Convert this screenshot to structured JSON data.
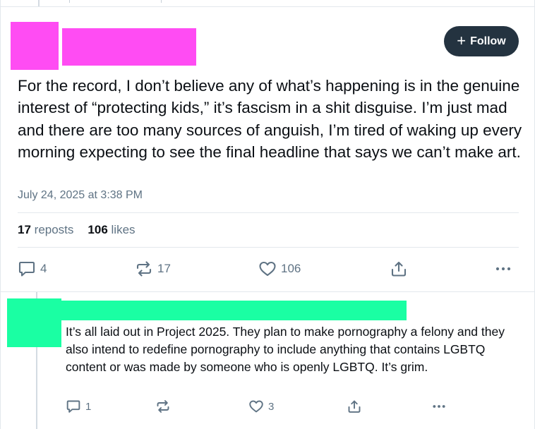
{
  "post": {
    "text": "For the record, I don’t believe any of what’s happening is in the genuine interest of “protecting kids,” it’s fascism in a shit disguise. I’m just mad and there are too many sources of anguish, I’m tired of waking up every morning expecting to see the final headline that says we can’t make art.",
    "date": "July 24, 2025 at 3:38 PM",
    "follow_label": "Follow",
    "stats": {
      "reposts_count": "17",
      "reposts_label": "reposts",
      "likes_count": "106",
      "likes_label": "likes"
    },
    "actions": {
      "replies": "4",
      "reposts": "17",
      "likes": "106"
    }
  },
  "reply": {
    "text": "It’s all laid out in Project 2025. They plan to make pornography a felony and they also intend to redefine pornography to include anything that contains LGBTQ content or was made by someone who is openly LGBTQ. It’s grim.",
    "actions": {
      "replies": "1",
      "likes": "3"
    }
  },
  "colors": {
    "redaction_main": "#ff4cf3",
    "redaction_reply": "#1affa3",
    "follow_button_bg": "#243340",
    "muted_text": "#5f7384"
  },
  "icons": [
    "plus-icon",
    "reply-icon",
    "repost-icon",
    "like-icon",
    "share-icon",
    "more-icon"
  ]
}
